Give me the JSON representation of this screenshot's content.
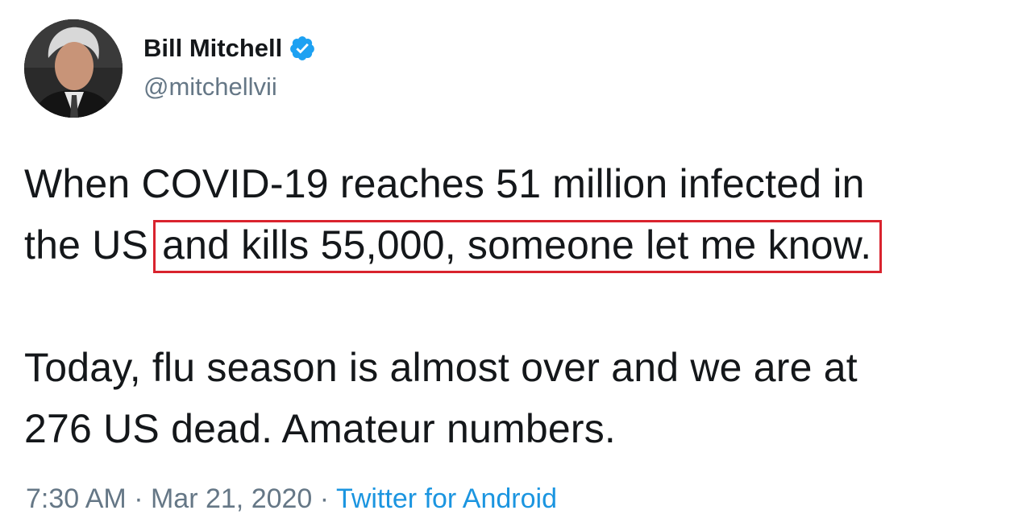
{
  "tweet": {
    "author": {
      "display_name": "Bill Mitchell",
      "handle": "@mitchellvii",
      "verified": true,
      "verified_icon": "verified-badge-icon"
    },
    "body": {
      "line1": "When COVID-19 reaches 51 million infected in",
      "line2_prefix": "the US",
      "line2_highlighted": "and kills 55,000, someone let me know.",
      "line3": "Today, flu season is almost over and we are at",
      "line4": "276 US dead. Amateur numbers."
    },
    "meta": {
      "time": "7:30 AM",
      "separator": "·",
      "date": "Mar 21, 2020",
      "source": "Twitter for Android"
    },
    "colors": {
      "text": "#14171a",
      "secondary": "#657786",
      "link": "#1b95e0",
      "verified": "#1da1f2",
      "highlight_box": "#d9232e"
    }
  }
}
